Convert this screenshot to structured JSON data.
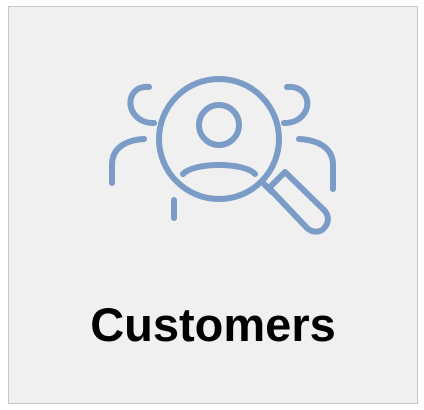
{
  "tile": {
    "label": "Customers",
    "icon": "customer-search-icon",
    "icon_color": "#7a9cc6",
    "background": "#f0f0f0",
    "border_color": "#c8c8c8"
  }
}
